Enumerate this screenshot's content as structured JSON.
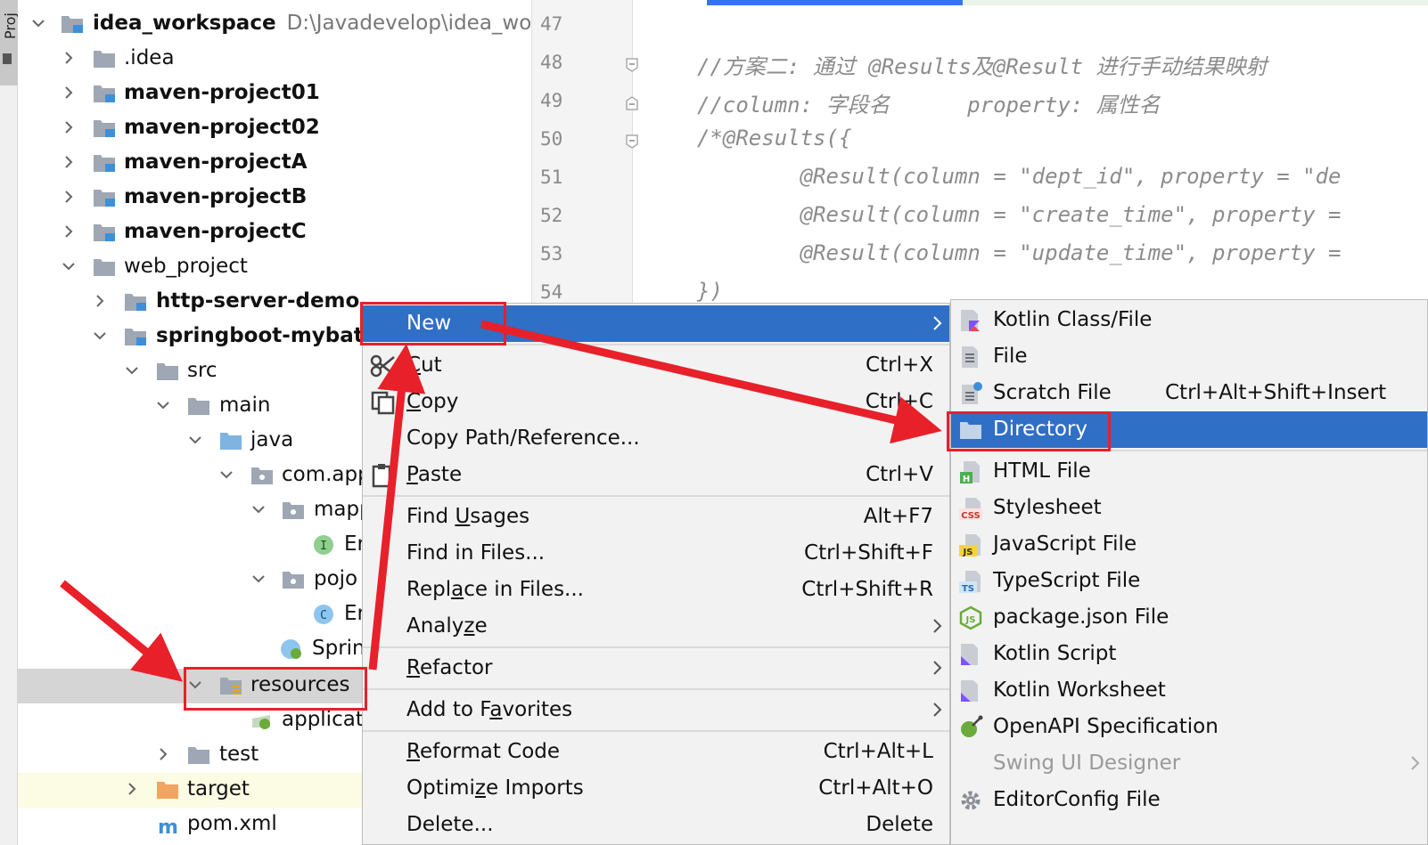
{
  "project_tab": {
    "label": "Proj"
  },
  "tree": {
    "root": {
      "name": "idea_workspace",
      "path": "D:\\Javadevelop\\idea_work"
    },
    "items": [
      {
        "label": ".idea"
      },
      {
        "label": "maven-project01"
      },
      {
        "label": "maven-project02"
      },
      {
        "label": "maven-projectA"
      },
      {
        "label": "maven-projectB"
      },
      {
        "label": "maven-projectC"
      },
      {
        "label": "web_project"
      },
      {
        "label": "http-server-demo"
      },
      {
        "label": "springboot-mybatis"
      },
      {
        "label": "src"
      },
      {
        "label": "main"
      },
      {
        "label": "java"
      },
      {
        "label": "com.app"
      },
      {
        "label": "mapp"
      },
      {
        "label": "Er"
      },
      {
        "label": "pojo"
      },
      {
        "label": "Er"
      },
      {
        "label": "Sprin"
      },
      {
        "label": "resources"
      },
      {
        "label": "applicati"
      },
      {
        "label": "test"
      },
      {
        "label": "target"
      },
      {
        "label": "pom.xml"
      }
    ]
  },
  "editor": {
    "line_numbers": [
      "47",
      "48",
      "49",
      "50",
      "51",
      "52",
      "53",
      "54"
    ],
    "lines": [
      "",
      "//方案二: 通过 @Results及@Result 进行手动结果映射",
      "//column: 字段名      property: 属性名",
      "/*@Results({",
      "        @Result(column = \"dept_id\", property = \"de",
      "        @Result(column = \"create_time\", property =",
      "        @Result(column = \"update_time\", property =",
      "})"
    ]
  },
  "context_menu": {
    "new": {
      "label": "New"
    },
    "cut": {
      "pre": "",
      "u": "C",
      "post": "ut",
      "shortcut": "Ctrl+X"
    },
    "copy": {
      "pre": "",
      "u": "C",
      "post": "opy",
      "shortcut": "Ctrl+C"
    },
    "copy_path": {
      "label": "Copy Path/Reference..."
    },
    "paste": {
      "pre": "",
      "u": "P",
      "post": "aste",
      "shortcut": "Ctrl+V"
    },
    "find_usages": {
      "pre": "Find ",
      "u": "U",
      "post": "sages",
      "shortcut": "Alt+F7"
    },
    "find_in_files": {
      "label": "Find in Files...",
      "shortcut": "Ctrl+Shift+F"
    },
    "replace_in_files": {
      "pre": "Repl",
      "u": "a",
      "post": "ce in Files...",
      "shortcut": "Ctrl+Shift+R"
    },
    "analyze": {
      "pre": "Analy",
      "u": "z",
      "post": "e"
    },
    "refactor": {
      "pre": "",
      "u": "R",
      "post": "efactor"
    },
    "add_to_favorites": {
      "pre": "Add to F",
      "u": "a",
      "post": "vorites"
    },
    "reformat_code": {
      "pre": "",
      "u": "R",
      "post": "eformat Code",
      "shortcut": "Ctrl+Alt+L"
    },
    "optimize_imports": {
      "pre": "Optimi",
      "u": "z",
      "post": "e Imports",
      "shortcut": "Ctrl+Alt+O"
    },
    "delete": {
      "label": "Delete...",
      "shortcut": "Delete"
    }
  },
  "submenu": {
    "kotlin_class": {
      "label": "Kotlin Class/File"
    },
    "file": {
      "label": "File"
    },
    "scratch_file": {
      "label": "Scratch File",
      "shortcut": "Ctrl+Alt+Shift+Insert"
    },
    "directory": {
      "label": "Directory"
    },
    "html_file": {
      "label": "HTML File"
    },
    "stylesheet": {
      "label": "Stylesheet"
    },
    "javascript_file": {
      "label": "JavaScript File"
    },
    "typescript_file": {
      "label": "TypeScript File"
    },
    "package_json": {
      "label": "package.json File"
    },
    "kotlin_script": {
      "label": "Kotlin Script"
    },
    "kotlin_worksheet": {
      "label": "Kotlin Worksheet"
    },
    "openapi": {
      "label": "OpenAPI Specification"
    },
    "swing_ui": {
      "label": "Swing UI Designer"
    },
    "editorconfig": {
      "label": "EditorConfig File"
    }
  },
  "icon_labels": {
    "css": "CSS",
    "js": "JS",
    "ts": "TS",
    "html": "H",
    "interface": "I",
    "class": "C",
    "package_json": "JS"
  },
  "colors": {
    "selection": "#2f6fc6",
    "annotation": "#e8202a",
    "folder": "#9ea7b3",
    "source_folder": "#7fb3e0",
    "excluded_folder": "#f2a462"
  }
}
